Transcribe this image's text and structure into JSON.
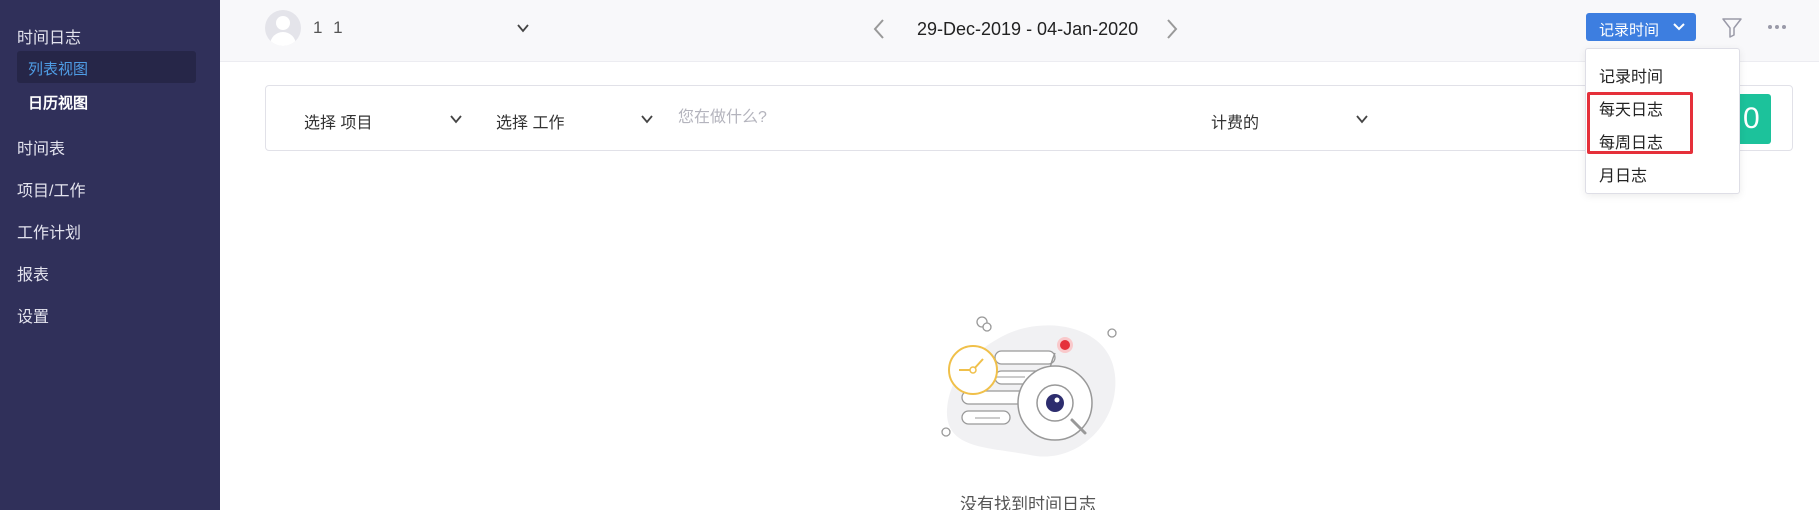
{
  "sidebar": {
    "section_title": "时间日志",
    "sub_items": [
      "列表视图",
      "日历视图"
    ],
    "items": [
      "时间表",
      "项目/工作",
      "工作计划",
      "报表",
      "设置"
    ]
  },
  "header": {
    "user_name": "1 1",
    "date_range": "29-Dec-2019 - 04-Jan-2020",
    "log_button_label": "记录时间"
  },
  "entry": {
    "project_select": "选择 项目",
    "job_select": "选择 工作",
    "description_placeholder": "您在做什么?",
    "billable_select": "计费的",
    "start_button_partial": "0"
  },
  "dropdown": {
    "items": [
      "记录时间",
      "每天日志",
      "每周日志",
      "月日志"
    ]
  },
  "empty_state": {
    "message": "没有找到时间日志"
  },
  "colors": {
    "sidebar_bg": "#30305a",
    "accent_blue": "#3d7ee0",
    "start_green": "#1cc29b",
    "highlight_red": "#e5303a"
  }
}
